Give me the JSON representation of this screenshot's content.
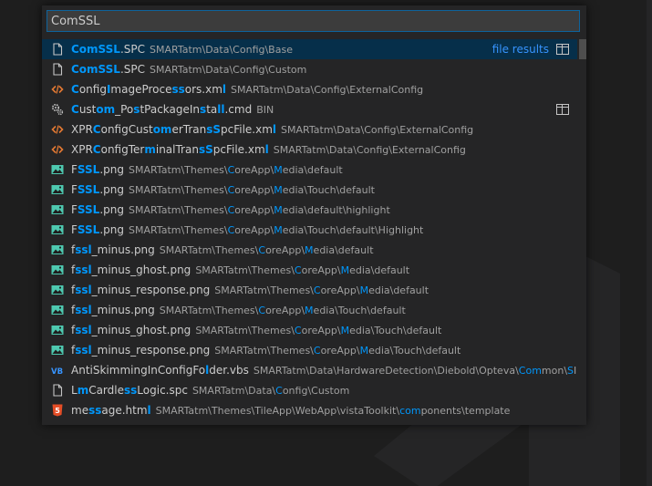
{
  "search": {
    "value": "ComSSL"
  },
  "results_header": {
    "file_results_label": "file results"
  },
  "results": [
    {
      "icon": "file-icon",
      "segments": [
        {
          "t": "ComSSL",
          "h": true
        },
        {
          "t": ".SPC",
          "h": false
        }
      ],
      "path": [
        {
          "t": "SMARTatm\\Data\\Config\\Base",
          "h": false
        }
      ],
      "selected": true,
      "label_right": "file results",
      "split": true
    },
    {
      "icon": "file-icon",
      "segments": [
        {
          "t": "ComSSL",
          "h": true
        },
        {
          "t": ".SPC",
          "h": false
        }
      ],
      "path": [
        {
          "t": "SMARTatm\\Data\\Config\\Custom",
          "h": false
        }
      ],
      "selected": false
    },
    {
      "icon": "xml-icon",
      "segments": [
        {
          "t": "C",
          "h": true
        },
        {
          "t": "onfig",
          "h": false
        },
        {
          "t": "I",
          "h": true
        },
        {
          "t": "mageProce",
          "h": false
        },
        {
          "t": "ss",
          "h": true
        },
        {
          "t": "ors.xm",
          "h": false
        },
        {
          "t": "l",
          "h": true
        }
      ],
      "path": [
        {
          "t": "SMARTatm\\Data\\Config\\ExternalConfig",
          "h": false
        }
      ],
      "selected": false
    },
    {
      "icon": "gear-icon",
      "segments": [
        {
          "t": "C",
          "h": true
        },
        {
          "t": "ust",
          "h": false
        },
        {
          "t": "om",
          "h": true
        },
        {
          "t": "_Po",
          "h": false
        },
        {
          "t": "s",
          "h": true
        },
        {
          "t": "tPackageIn",
          "h": false
        },
        {
          "t": "s",
          "h": true
        },
        {
          "t": "ta",
          "h": false
        },
        {
          "t": "ll",
          "h": true
        },
        {
          "t": ".cmd",
          "h": false
        }
      ],
      "path": [
        {
          "t": "BIN",
          "h": false
        }
      ],
      "selected": false,
      "split": true
    },
    {
      "icon": "xml-icon",
      "segments": [
        {
          "t": "XPR",
          "h": false
        },
        {
          "t": "C",
          "h": true
        },
        {
          "t": "onfigCust",
          "h": false
        },
        {
          "t": "om",
          "h": true
        },
        {
          "t": "erTran",
          "h": false
        },
        {
          "t": "sS",
          "h": true
        },
        {
          "t": "pcFile.xm",
          "h": false
        },
        {
          "t": "l",
          "h": true
        }
      ],
      "path": [
        {
          "t": "SMARTatm\\Data\\Config\\ExternalConfig",
          "h": false
        }
      ],
      "selected": false
    },
    {
      "icon": "xml-icon",
      "segments": [
        {
          "t": "XPR",
          "h": false
        },
        {
          "t": "C",
          "h": true
        },
        {
          "t": "onfigTer",
          "h": false
        },
        {
          "t": "m",
          "h": true
        },
        {
          "t": "inalTran",
          "h": false
        },
        {
          "t": "sS",
          "h": true
        },
        {
          "t": "pcFile.xm",
          "h": false
        },
        {
          "t": "l",
          "h": true
        }
      ],
      "path": [
        {
          "t": "SMARTatm\\Data\\Config\\ExternalConfig",
          "h": false
        }
      ],
      "selected": false
    },
    {
      "icon": "image-icon",
      "segments": [
        {
          "t": "F",
          "h": false
        },
        {
          "t": "SSL",
          "h": true
        },
        {
          "t": ".png",
          "h": false
        }
      ],
      "path": [
        {
          "t": "SMARTatm\\Themes\\",
          "h": false
        },
        {
          "t": "C",
          "h": true
        },
        {
          "t": "oreApp\\",
          "h": false
        },
        {
          "t": "M",
          "h": true
        },
        {
          "t": "edia\\default",
          "h": false
        }
      ],
      "selected": false
    },
    {
      "icon": "image-icon",
      "segments": [
        {
          "t": "F",
          "h": false
        },
        {
          "t": "SSL",
          "h": true
        },
        {
          "t": ".png",
          "h": false
        }
      ],
      "path": [
        {
          "t": "SMARTatm\\Themes\\",
          "h": false
        },
        {
          "t": "C",
          "h": true
        },
        {
          "t": "oreApp\\",
          "h": false
        },
        {
          "t": "M",
          "h": true
        },
        {
          "t": "edia\\Touch\\default",
          "h": false
        }
      ],
      "selected": false
    },
    {
      "icon": "image-icon",
      "segments": [
        {
          "t": "F",
          "h": false
        },
        {
          "t": "SSL",
          "h": true
        },
        {
          "t": ".png",
          "h": false
        }
      ],
      "path": [
        {
          "t": "SMARTatm\\Themes\\",
          "h": false
        },
        {
          "t": "C",
          "h": true
        },
        {
          "t": "oreApp\\",
          "h": false
        },
        {
          "t": "M",
          "h": true
        },
        {
          "t": "edia\\default\\highlight",
          "h": false
        }
      ],
      "selected": false
    },
    {
      "icon": "image-icon",
      "segments": [
        {
          "t": "F",
          "h": false
        },
        {
          "t": "SSL",
          "h": true
        },
        {
          "t": ".png",
          "h": false
        }
      ],
      "path": [
        {
          "t": "SMARTatm\\Themes\\",
          "h": false
        },
        {
          "t": "C",
          "h": true
        },
        {
          "t": "oreApp\\",
          "h": false
        },
        {
          "t": "M",
          "h": true
        },
        {
          "t": "edia\\Touch\\default\\Highlight",
          "h": false
        }
      ],
      "selected": false
    },
    {
      "icon": "image-icon",
      "segments": [
        {
          "t": "f",
          "h": false
        },
        {
          "t": "ssl",
          "h": true
        },
        {
          "t": "_minus.png",
          "h": false
        }
      ],
      "path": [
        {
          "t": "SMARTatm\\Themes\\",
          "h": false
        },
        {
          "t": "C",
          "h": true
        },
        {
          "t": "oreApp\\",
          "h": false
        },
        {
          "t": "M",
          "h": true
        },
        {
          "t": "edia\\default",
          "h": false
        }
      ],
      "selected": false
    },
    {
      "icon": "image-icon",
      "segments": [
        {
          "t": "f",
          "h": false
        },
        {
          "t": "ssl",
          "h": true
        },
        {
          "t": "_minus_ghost.png",
          "h": false
        }
      ],
      "path": [
        {
          "t": "SMARTatm\\Themes\\",
          "h": false
        },
        {
          "t": "C",
          "h": true
        },
        {
          "t": "oreApp\\",
          "h": false
        },
        {
          "t": "M",
          "h": true
        },
        {
          "t": "edia\\default",
          "h": false
        }
      ],
      "selected": false
    },
    {
      "icon": "image-icon",
      "segments": [
        {
          "t": "f",
          "h": false
        },
        {
          "t": "ssl",
          "h": true
        },
        {
          "t": "_minus_response.png",
          "h": false
        }
      ],
      "path": [
        {
          "t": "SMARTatm\\Themes\\",
          "h": false
        },
        {
          "t": "C",
          "h": true
        },
        {
          "t": "oreApp\\",
          "h": false
        },
        {
          "t": "M",
          "h": true
        },
        {
          "t": "edia\\default",
          "h": false
        }
      ],
      "selected": false
    },
    {
      "icon": "image-icon",
      "segments": [
        {
          "t": "f",
          "h": false
        },
        {
          "t": "ssl",
          "h": true
        },
        {
          "t": "_minus.png",
          "h": false
        }
      ],
      "path": [
        {
          "t": "SMARTatm\\Themes\\",
          "h": false
        },
        {
          "t": "C",
          "h": true
        },
        {
          "t": "oreApp\\",
          "h": false
        },
        {
          "t": "M",
          "h": true
        },
        {
          "t": "edia\\Touch\\default",
          "h": false
        }
      ],
      "selected": false
    },
    {
      "icon": "image-icon",
      "segments": [
        {
          "t": "f",
          "h": false
        },
        {
          "t": "ssl",
          "h": true
        },
        {
          "t": "_minus_ghost.png",
          "h": false
        }
      ],
      "path": [
        {
          "t": "SMARTatm\\Themes\\",
          "h": false
        },
        {
          "t": "C",
          "h": true
        },
        {
          "t": "oreApp\\",
          "h": false
        },
        {
          "t": "M",
          "h": true
        },
        {
          "t": "edia\\Touch\\default",
          "h": false
        }
      ],
      "selected": false
    },
    {
      "icon": "image-icon",
      "segments": [
        {
          "t": "f",
          "h": false
        },
        {
          "t": "ssl",
          "h": true
        },
        {
          "t": "_minus_response.png",
          "h": false
        }
      ],
      "path": [
        {
          "t": "SMARTatm\\Themes\\",
          "h": false
        },
        {
          "t": "C",
          "h": true
        },
        {
          "t": "oreApp\\",
          "h": false
        },
        {
          "t": "M",
          "h": true
        },
        {
          "t": "edia\\Touch\\default",
          "h": false
        }
      ],
      "selected": false
    },
    {
      "icon": "vbs-icon",
      "segments": [
        {
          "t": "AntiSkimmingInConfigFo",
          "h": false
        },
        {
          "t": "l",
          "h": true
        },
        {
          "t": "der.vbs",
          "h": false
        }
      ],
      "path": [
        {
          "t": "SMARTatm\\Data\\HardwareDetection\\Diebold\\Opteva\\",
          "h": false
        },
        {
          "t": "Com",
          "h": true
        },
        {
          "t": "mon\\",
          "h": false
        },
        {
          "t": "S",
          "h": true
        },
        {
          "t": "IU",
          "h": false
        }
      ],
      "selected": false
    },
    {
      "icon": "file-icon",
      "segments": [
        {
          "t": "L",
          "h": false
        },
        {
          "t": "m",
          "h": true
        },
        {
          "t": "Cardle",
          "h": false
        },
        {
          "t": "ss",
          "h": true
        },
        {
          "t": "Logic.spc",
          "h": false
        }
      ],
      "path": [
        {
          "t": "SMARTatm\\Data\\",
          "h": false
        },
        {
          "t": "C",
          "h": true
        },
        {
          "t": "onfig\\Custom",
          "h": false
        }
      ],
      "selected": false
    },
    {
      "icon": "html5-icon",
      "segments": [
        {
          "t": "me",
          "h": false
        },
        {
          "t": "ss",
          "h": true
        },
        {
          "t": "age.htm",
          "h": false
        },
        {
          "t": "l",
          "h": true
        }
      ],
      "path": [
        {
          "t": "SMARTatm\\Themes\\TileApp\\WebApp\\vistaToolkit\\",
          "h": false
        },
        {
          "t": "com",
          "h": true
        },
        {
          "t": "ponents\\template",
          "h": false
        }
      ],
      "selected": false
    }
  ],
  "icons": {
    "file-icon": {
      "color": "#c5c5c5"
    },
    "xml-icon": {
      "color": "#e37933"
    },
    "gear-icon": {
      "color": "#c5c5c5"
    },
    "image-icon": {
      "color": "#4ec9b0"
    },
    "vbs-icon": {
      "color": "#3794ff",
      "glyph": "VB"
    },
    "html5-icon": {
      "color": "#e44d26",
      "glyph": "5"
    }
  },
  "colors": {
    "highlight": "#0097fb",
    "selection": "#062f4a",
    "background": "#1e1e1e",
    "panel": "#252526"
  }
}
